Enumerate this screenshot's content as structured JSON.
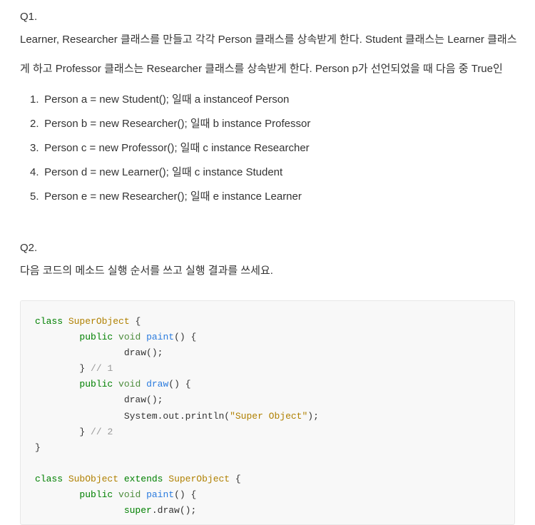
{
  "q1": {
    "heading": "Q1.",
    "desc_line1": "Learner, Researcher 클래스를 만들고 각각 Person 클래스를 상속받게 한다. Student 클래스는 Learner 클래스",
    "desc_line2": "게 하고 Professor 클래스는 Researcher 클래스를 상속받게 한다. Person p가 선언되었을 때 다음 중 True인",
    "options": [
      "Person a = new Student(); 일때 a instanceof Person",
      "Person b = new Researcher(); 일때 b instance Professor",
      "Person c = new Professor(); 일때 c instance Researcher",
      "Person d = new Learner(); 일때 c instance Student",
      "Person e = new Researcher(); 일때 e instance Learner"
    ]
  },
  "q2": {
    "heading": "Q2.",
    "desc": "다음 코드의 메소드 실행 순서를 쓰고 실행 결과를 쓰세요."
  },
  "code": {
    "tokens": [
      {
        "t": "kw",
        "v": "class"
      },
      {
        "t": "sp",
        "v": " "
      },
      {
        "t": "clsname",
        "v": "SuperObject"
      },
      {
        "t": "sp",
        "v": " "
      },
      {
        "t": "punct",
        "v": "{"
      },
      {
        "t": "nl"
      },
      {
        "t": "sp",
        "v": "        "
      },
      {
        "t": "kw",
        "v": "public"
      },
      {
        "t": "sp",
        "v": " "
      },
      {
        "t": "type",
        "v": "void"
      },
      {
        "t": "sp",
        "v": " "
      },
      {
        "t": "method",
        "v": "paint"
      },
      {
        "t": "punct",
        "v": "()"
      },
      {
        "t": "sp",
        "v": " "
      },
      {
        "t": "punct",
        "v": "{"
      },
      {
        "t": "nl"
      },
      {
        "t": "sp",
        "v": "                "
      },
      {
        "t": "punct",
        "v": "draw();"
      },
      {
        "t": "nl"
      },
      {
        "t": "sp",
        "v": "        "
      },
      {
        "t": "punct",
        "v": "}"
      },
      {
        "t": "sp",
        "v": " "
      },
      {
        "t": "comment",
        "v": "// 1"
      },
      {
        "t": "nl"
      },
      {
        "t": "sp",
        "v": "        "
      },
      {
        "t": "kw",
        "v": "public"
      },
      {
        "t": "sp",
        "v": " "
      },
      {
        "t": "type",
        "v": "void"
      },
      {
        "t": "sp",
        "v": " "
      },
      {
        "t": "method",
        "v": "draw"
      },
      {
        "t": "punct",
        "v": "()"
      },
      {
        "t": "sp",
        "v": " "
      },
      {
        "t": "punct",
        "v": "{"
      },
      {
        "t": "nl"
      },
      {
        "t": "sp",
        "v": "                "
      },
      {
        "t": "punct",
        "v": "draw();"
      },
      {
        "t": "nl"
      },
      {
        "t": "sp",
        "v": "                "
      },
      {
        "t": "punct",
        "v": "System.out.println("
      },
      {
        "t": "string",
        "v": "\"Super Object\""
      },
      {
        "t": "punct",
        "v": ");"
      },
      {
        "t": "nl"
      },
      {
        "t": "sp",
        "v": "        "
      },
      {
        "t": "punct",
        "v": "}"
      },
      {
        "t": "sp",
        "v": " "
      },
      {
        "t": "comment",
        "v": "// 2"
      },
      {
        "t": "nl"
      },
      {
        "t": "punct",
        "v": "}"
      },
      {
        "t": "nl"
      },
      {
        "t": "nl"
      },
      {
        "t": "kw",
        "v": "class"
      },
      {
        "t": "sp",
        "v": " "
      },
      {
        "t": "clsname",
        "v": "SubObject"
      },
      {
        "t": "sp",
        "v": " "
      },
      {
        "t": "kw",
        "v": "extends"
      },
      {
        "t": "sp",
        "v": " "
      },
      {
        "t": "clsname",
        "v": "SuperObject"
      },
      {
        "t": "sp",
        "v": " "
      },
      {
        "t": "punct",
        "v": "{"
      },
      {
        "t": "nl"
      },
      {
        "t": "sp",
        "v": "        "
      },
      {
        "t": "kw",
        "v": "public"
      },
      {
        "t": "sp",
        "v": " "
      },
      {
        "t": "type",
        "v": "void"
      },
      {
        "t": "sp",
        "v": " "
      },
      {
        "t": "method",
        "v": "paint"
      },
      {
        "t": "punct",
        "v": "()"
      },
      {
        "t": "sp",
        "v": " "
      },
      {
        "t": "punct",
        "v": "{"
      },
      {
        "t": "nl"
      },
      {
        "t": "sp",
        "v": "                "
      },
      {
        "t": "kw",
        "v": "super"
      },
      {
        "t": "punct",
        "v": ".draw();"
      },
      {
        "t": "nl"
      }
    ]
  }
}
